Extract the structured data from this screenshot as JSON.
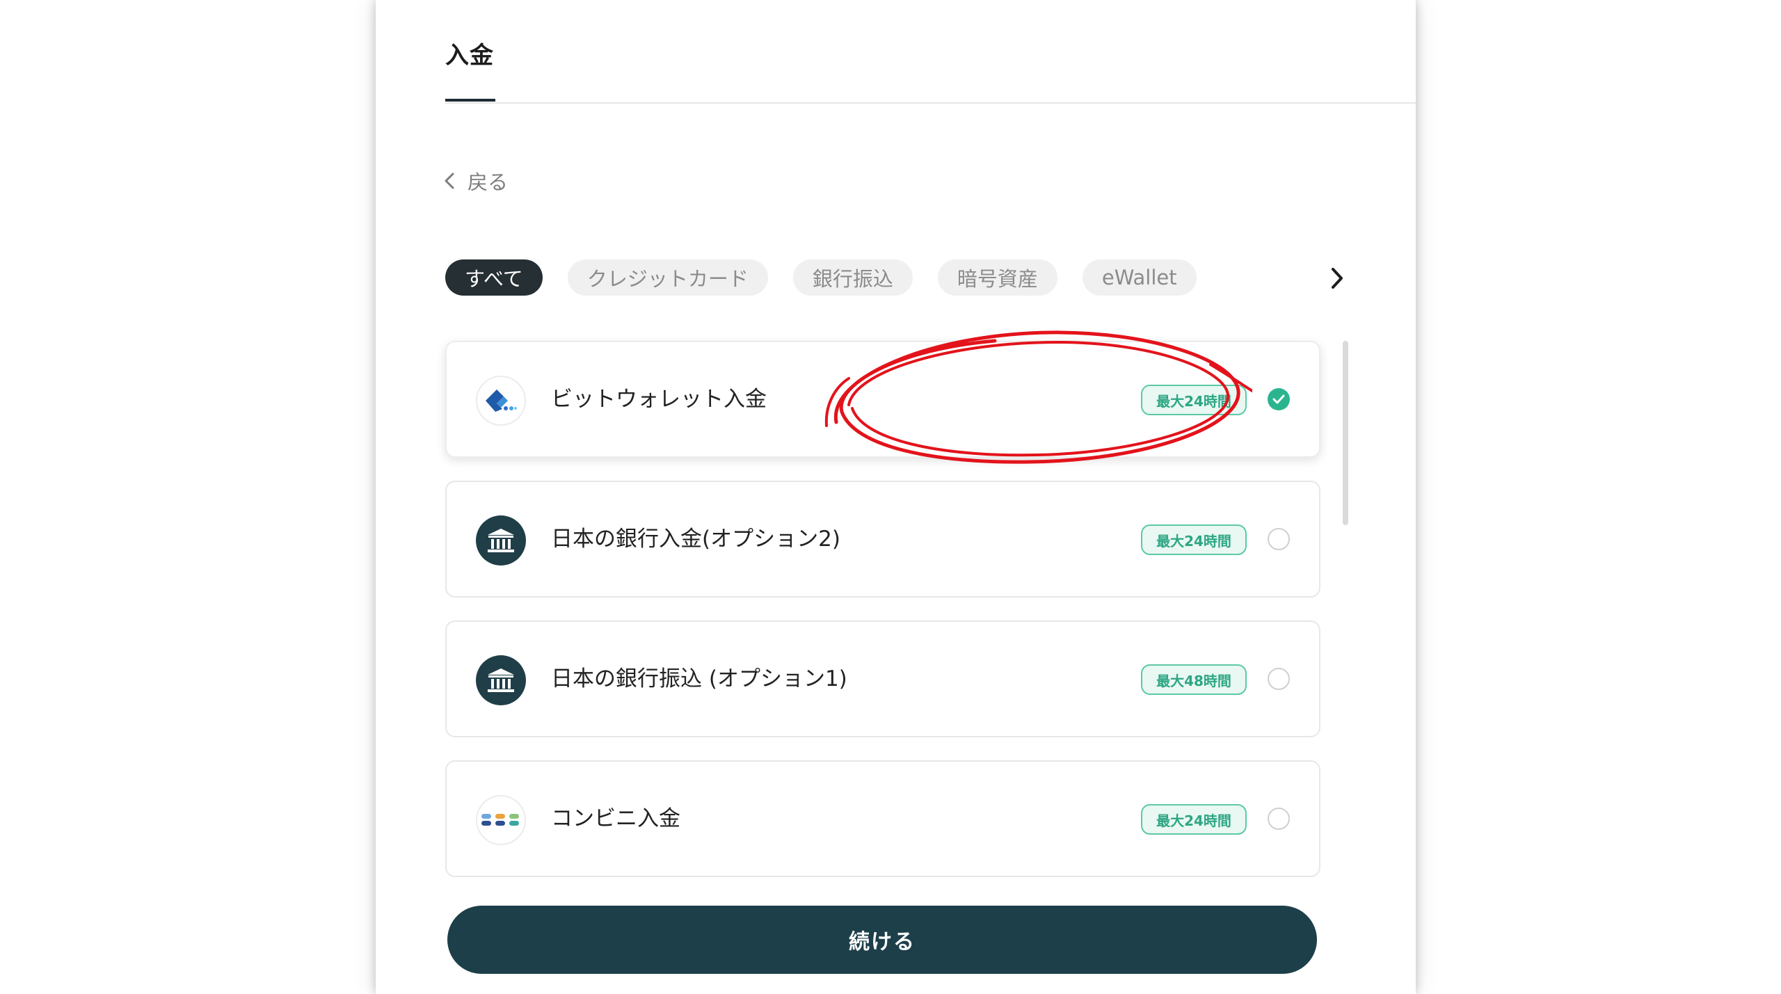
{
  "header": {
    "title": "入金"
  },
  "back": {
    "label": "戻る"
  },
  "tabs": [
    {
      "label": "すべて",
      "active": true
    },
    {
      "label": "クレジットカード",
      "active": false
    },
    {
      "label": "銀行振込",
      "active": false
    },
    {
      "label": "暗号資産",
      "active": false
    },
    {
      "label": "eWallet",
      "active": false
    }
  ],
  "methods": [
    {
      "name": "ビットウォレット入金",
      "badge": "最大24時間",
      "icon": "bitwallet-logo-icon",
      "selected": true
    },
    {
      "name": "日本の銀行入金(オプション2)",
      "badge": "最大24時間",
      "icon": "bank-icon",
      "selected": false
    },
    {
      "name": "日本の銀行振込 (オプション1)",
      "badge": "最大48時間",
      "icon": "bank-icon",
      "selected": false
    },
    {
      "name": "コンビニ入金",
      "badge": "最大24時間",
      "icon": "convenience-store-icon",
      "selected": false
    }
  ],
  "actions": {
    "continue_label": "続ける"
  },
  "colors": {
    "primary_dark": "#1d3f4a",
    "accent_green": "#2bb58e",
    "badge_border": "#5cc9a6",
    "annotation_red": "#e3131b"
  }
}
